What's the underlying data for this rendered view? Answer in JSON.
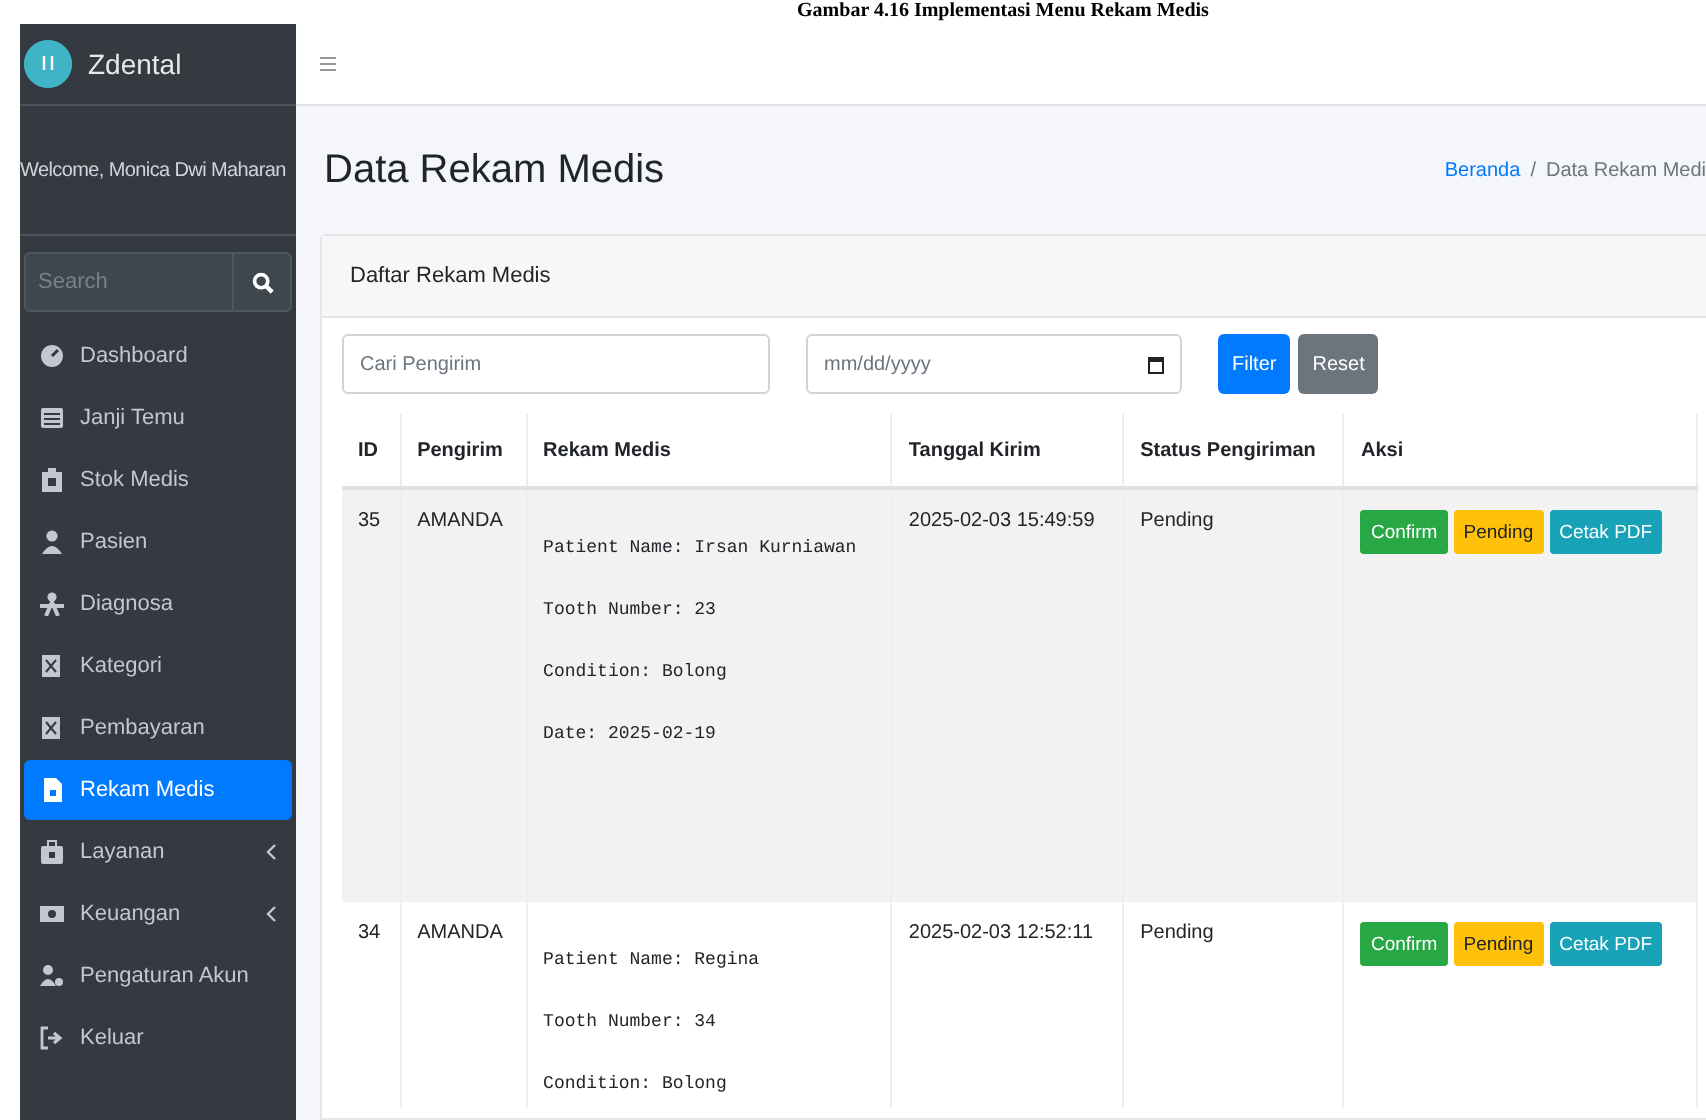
{
  "caption": "Gambar 4.16 Implementasi Menu Rekam Medis",
  "sidebar": {
    "brand": "Zdental",
    "welcome": "Welcome, Monica Dwi Maharan",
    "search": {
      "placeholder": "Search"
    },
    "items": [
      {
        "label": "Dashboard",
        "selected": false,
        "has_submenu": false
      },
      {
        "label": "Janji Temu",
        "selected": false,
        "has_submenu": false
      },
      {
        "label": "Stok Medis",
        "selected": false,
        "has_submenu": false
      },
      {
        "label": "Pasien",
        "selected": false,
        "has_submenu": false
      },
      {
        "label": "Diagnosa",
        "selected": false,
        "has_submenu": false
      },
      {
        "label": "Kategori",
        "selected": false,
        "has_submenu": false
      },
      {
        "label": "Pembayaran",
        "selected": false,
        "has_submenu": false
      },
      {
        "label": "Rekam Medis",
        "selected": true,
        "has_submenu": false
      },
      {
        "label": "Layanan",
        "selected": false,
        "has_submenu": true
      },
      {
        "label": "Keuangan",
        "selected": false,
        "has_submenu": true
      },
      {
        "label": "Pengaturan Akun",
        "selected": false,
        "has_submenu": false
      },
      {
        "label": "Keluar",
        "selected": false,
        "has_submenu": false
      }
    ]
  },
  "page": {
    "title": "Data Rekam Medis",
    "breadcrumb": [
      "Beranda",
      "Data Rekam Medi"
    ],
    "breadcrumb_separator": "/"
  },
  "card": {
    "title": "Daftar Rekam Medis",
    "filters": {
      "sender": {
        "placeholder": "Cari Pengirim"
      },
      "date": {
        "placeholder": "mm/dd/yyyy"
      },
      "buttons": [
        "Filter",
        "Reset"
      ]
    },
    "table": {
      "columns": [
        "ID",
        "Pengirim",
        "Rekam Medis",
        "Tanggal Kirim",
        "Status Pengiriman",
        "Aksi"
      ],
      "rows": [
        {
          "id": "35",
          "sender": "AMANDA",
          "highlighted": true,
          "record": [
            "Patient Name: Irsan Kurniawan",
            "Tooth Number: 23",
            "Condition: Bolong",
            "Date: 2025-02-19"
          ],
          "sent": "2025-02-03 15:49:59",
          "status": "Pending",
          "actions": [
            "Confirm",
            "Pending",
            "Cetak PDF"
          ]
        },
        {
          "id": "34",
          "sender": "AMANDA",
          "highlighted": false,
          "record": [
            "Patient Name: Regina",
            "Tooth Number: 34",
            "Condition: Bolong"
          ],
          "sent": "2025-02-03 12:52:11",
          "status": "Pending",
          "actions": [
            "Confirm",
            "Pending",
            "Cetak PDF"
          ]
        }
      ]
    }
  }
}
